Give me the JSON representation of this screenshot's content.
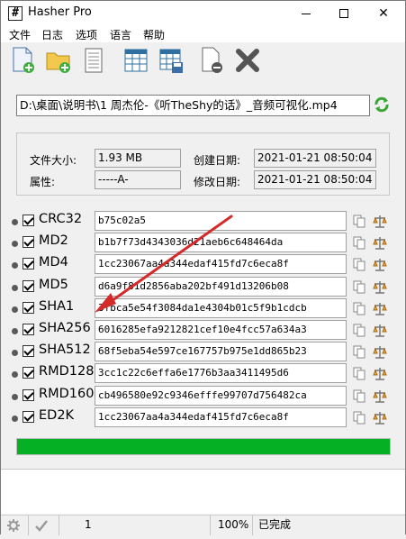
{
  "window": {
    "title": "Hasher Pro",
    "icon": "hash-icon"
  },
  "menu": {
    "items": [
      "文件",
      "日志",
      "选项",
      "语言",
      "帮助"
    ]
  },
  "file": {
    "path": "D:\\桌面\\说明书\\1 周杰伦-《听TheShy的话》_音频可视化.mp4"
  },
  "info": {
    "size_label": "文件大小:",
    "size_value": "1.93 MB",
    "attr_label": "属性:",
    "attr_value": "-----A-",
    "created_label": "创建日期:",
    "created_value": "2021-01-21 08:50:04",
    "modified_label": "修改日期:",
    "modified_value": "2021-01-21 08:50:04"
  },
  "hashes": [
    {
      "name": "CRC32",
      "value": "b75c02a5"
    },
    {
      "name": "MD2",
      "value": "b1b7f73d4343036d21aeb6c648464da"
    },
    {
      "name": "MD4",
      "value": "1cc23067aa4a344edaf415fd7c6eca8f"
    },
    {
      "name": "MD5",
      "value": "d6a9f81d2856aba202bf491d13206b08"
    },
    {
      "name": "SHA1",
      "value": "3fbca5e54f3084da1e4304b01c5f9b1cdcb"
    },
    {
      "name": "SHA256",
      "value": "6016285efa9212821cef10e4fcc57a634a3"
    },
    {
      "name": "SHA512",
      "value": "68f5eba54e597ce167757b975e1dd865b23"
    },
    {
      "name": "RMD128",
      "value": "3cc1c22c6effa6e1776b3aa3411495d6"
    },
    {
      "name": "RMD160",
      "value": "cb496580e92c9346efffe99707d756482ca"
    },
    {
      "name": "ED2K",
      "value": "1cc23067aa4a344edaf415fd7c6eca8f"
    }
  ],
  "progress": {
    "percent": 100,
    "color": "#06b025"
  },
  "status": {
    "count": "1",
    "zoom": "100%",
    "state": "已完成"
  }
}
